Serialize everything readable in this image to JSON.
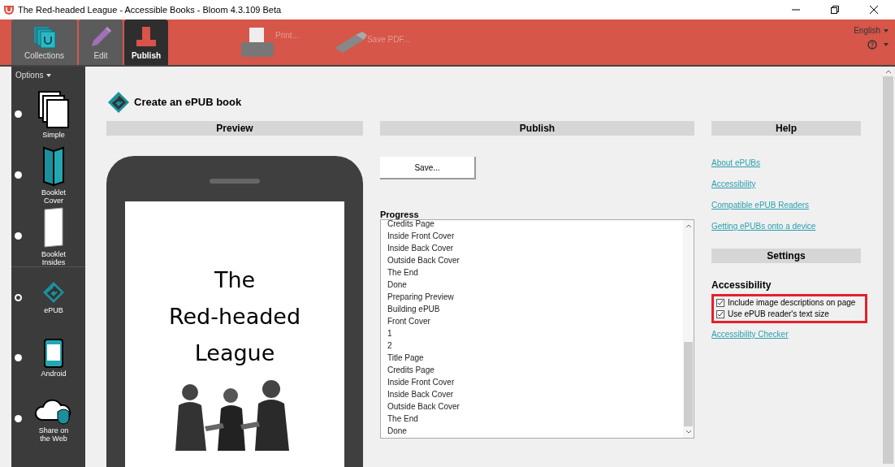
{
  "window": {
    "title": "The Red-headed League - Accessible Books - Bloom 4.3.109 Beta"
  },
  "tabs": [
    {
      "label": "Collections",
      "selected": false
    },
    {
      "label": "Edit",
      "selected": false
    },
    {
      "label": "Publish",
      "selected": true
    }
  ],
  "toolbar": [
    {
      "label": "Print...",
      "kind": "printer",
      "disabled": true
    },
    {
      "label": "Save PDF...",
      "kind": "drive",
      "disabled": true
    }
  ],
  "language": "English",
  "sidebar": {
    "title": "Options",
    "items": [
      {
        "label": "Simple",
        "kind": "pages",
        "selected": false
      },
      {
        "label": "Booklet Cover",
        "kind": "cover",
        "selected": false
      },
      {
        "label": "Booklet Insides",
        "kind": "insides",
        "selected": false
      },
      {
        "label": "ePUB",
        "kind": "epub",
        "selected": true
      },
      {
        "label": "Android",
        "kind": "android",
        "selected": false
      },
      {
        "label": "Share on the Web",
        "kind": "cloud",
        "selected": false
      }
    ]
  },
  "heading": "Create an ePUB book",
  "preview": {
    "header": "Preview",
    "book_title_lines": [
      "The",
      "Red-headed",
      "League"
    ],
    "illustration": {
      "kind": "picture"
    }
  },
  "publish": {
    "header": "Publish",
    "save_button": "Save...",
    "progress_label": "Progress",
    "progress": [
      "Credits Page",
      "Inside Front Cover",
      "Inside Back Cover",
      "Outside Back Cover",
      "The End",
      "Done",
      "Preparing Preview",
      "Building ePUB",
      "Front Cover",
      "1",
      "2",
      "Title Page",
      "Credits Page",
      "Inside Front Cover",
      "Inside Back Cover",
      "Outside Back Cover",
      "The End",
      "Done"
    ]
  },
  "help": {
    "header": "Help",
    "links": [
      "About ePUBs",
      "Accessibility",
      "Compatible ePUB Readers",
      "Getting ePUBs onto a device"
    ]
  },
  "settings": {
    "header": "Settings",
    "group": "Accessibility",
    "highlighted": true,
    "options": [
      {
        "label": "Include image descriptions on page",
        "checked": true
      },
      {
        "label": "Use ePUB reader's text size",
        "checked": true
      }
    ],
    "link": "Accessibility Checker"
  }
}
